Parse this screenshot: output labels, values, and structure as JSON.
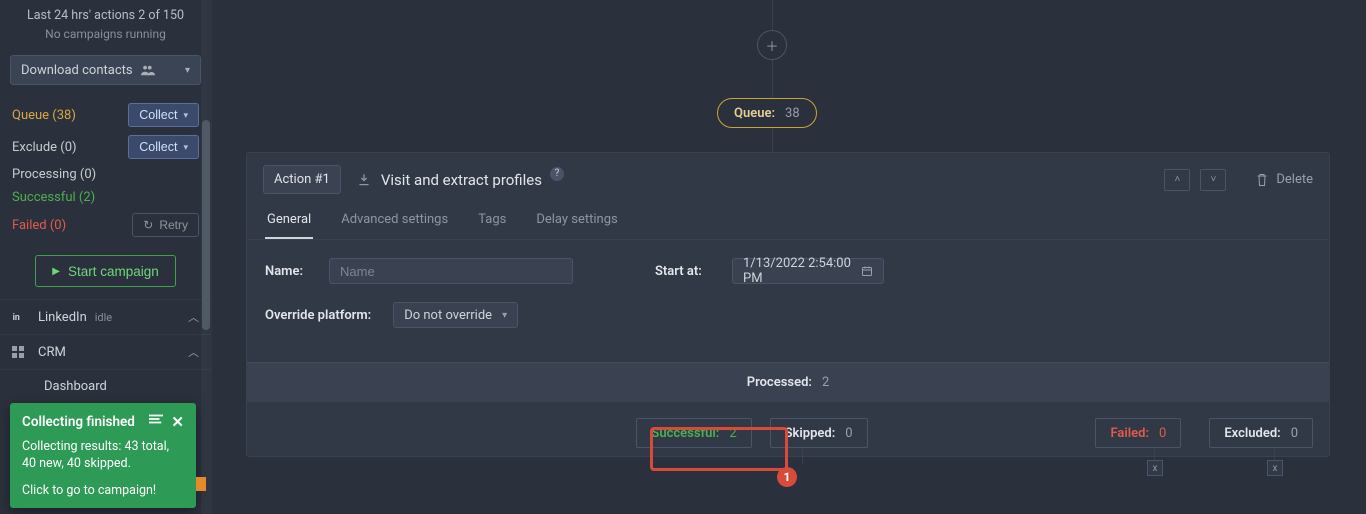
{
  "sidebar": {
    "topline": "Last 24 hrs' actions 2 of 150",
    "noCampaigns": "No campaigns running",
    "download": "Download contacts",
    "queue": {
      "label": "Queue (38)",
      "btn": "Collect"
    },
    "exclude": {
      "label": "Exclude (0)",
      "btn": "Collect"
    },
    "processing": "Processing (0)",
    "successful": "Successful (2)",
    "failed": {
      "label": "Failed (0)",
      "btn": "Retry"
    },
    "start": "Start campaign",
    "nav": {
      "linkedin": {
        "label": "LinkedIn",
        "status": "idle"
      },
      "crm": "CRM",
      "dashboard": "Dashboard"
    }
  },
  "toast": {
    "title": "Collecting finished",
    "body": "Collecting results: 43 total, 40 new, 40 skipped.",
    "cta": "Click to go to campaign!"
  },
  "flow": {
    "queueChip": {
      "key": "Queue:",
      "value": "38"
    }
  },
  "card": {
    "action": "Action #1",
    "title": "Visit and extract profiles",
    "delete": "Delete",
    "tabs": {
      "general": "General",
      "advanced": "Advanced settings",
      "tags": "Tags",
      "delay": "Delay settings"
    },
    "form": {
      "nameLabel": "Name:",
      "namePlaceholder": "Name",
      "startLabel": "Start at:",
      "startValue": "1/13/2022 2:54:00 PM",
      "overrideLabel": "Override platform:",
      "overrideValue": "Do not override"
    },
    "processed": {
      "key": "Processed:",
      "value": "2"
    },
    "status": {
      "successful": {
        "key": "Successful:",
        "value": "2"
      },
      "skipped": {
        "key": "Skipped:",
        "value": "0"
      },
      "failed": {
        "key": "Failed:",
        "value": "0"
      },
      "excluded": {
        "key": "Excluded:",
        "value": "0"
      }
    }
  },
  "annotation": {
    "badge": "1"
  }
}
